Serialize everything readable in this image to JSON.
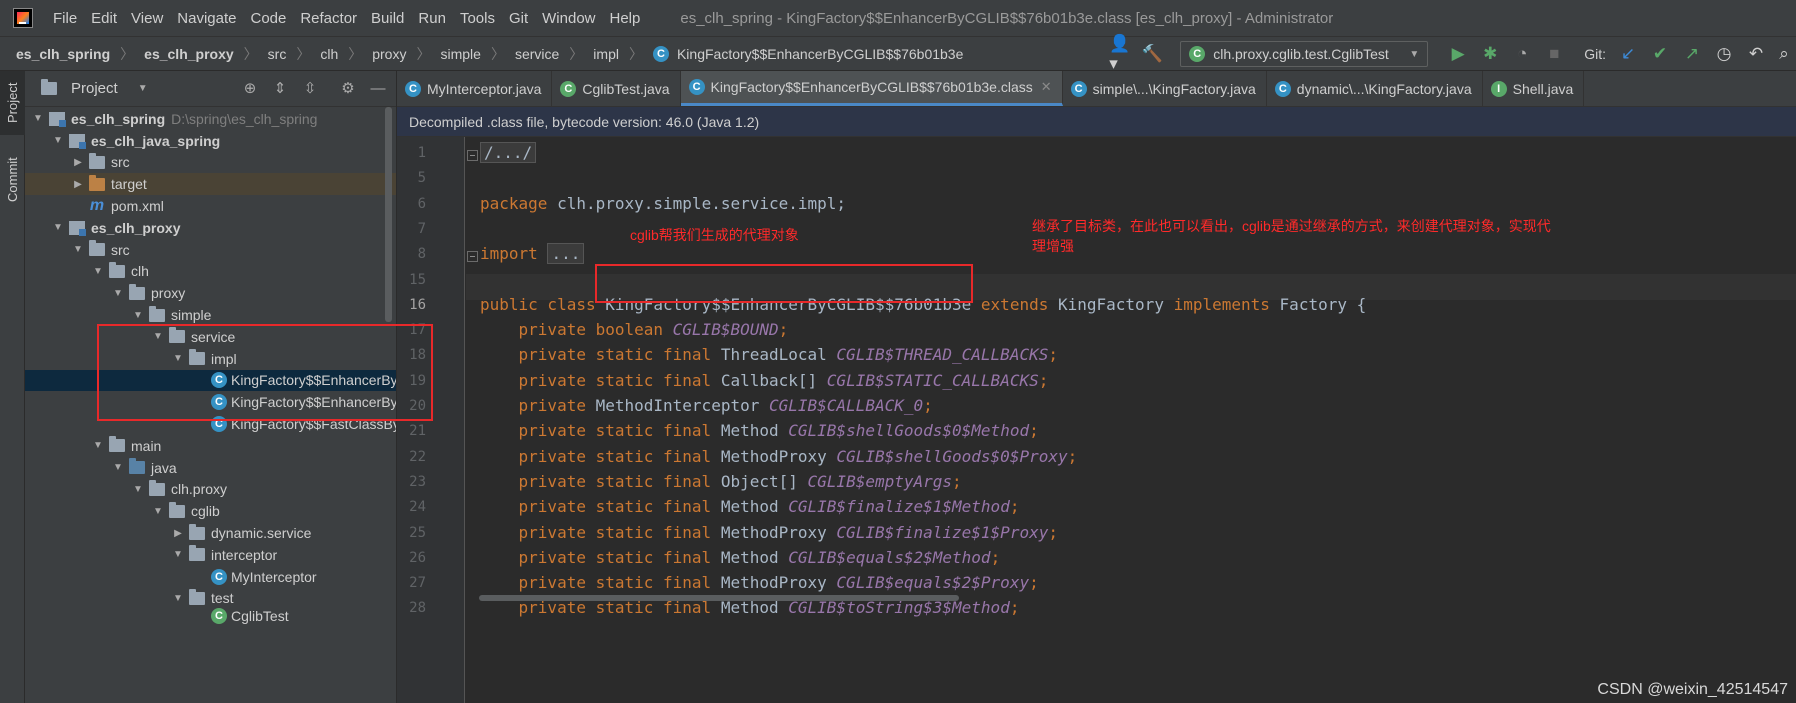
{
  "menubar": {
    "items": [
      "File",
      "Edit",
      "View",
      "Navigate",
      "Code",
      "Refactor",
      "Build",
      "Run",
      "Tools",
      "Git",
      "Window",
      "Help"
    ],
    "title": "es_clh_spring - KingFactory$$EnhancerByCGLIB$$76b01b3e.class [es_clh_proxy] - Administrator"
  },
  "breadcrumb": [
    "es_clh_spring",
    "es_clh_proxy",
    "src",
    "clh",
    "proxy",
    "simple",
    "service",
    "impl",
    "KingFactory$$EnhancerByCGLIB$$76b01b3e"
  ],
  "toolbar": {
    "run_config": "clh.proxy.cglib.test.CglibTest",
    "git_label": "Git:",
    "icons": [
      "user-icon",
      "hammer-icon",
      "run-icon",
      "debug-icon",
      "coverage-icon",
      "stop-icon",
      "git-update-icon",
      "git-commit-icon",
      "git-push-icon",
      "history-icon",
      "rollback-icon"
    ]
  },
  "stripe": {
    "project_label": "Project",
    "commit_label": "Commit"
  },
  "project_panel": {
    "title": "Project",
    "tree": [
      {
        "label": "es_clh_spring",
        "hint": "D:\\spring\\es_clh_spring"
      },
      {
        "label": "es_clh_java_spring"
      },
      {
        "label": "src"
      },
      {
        "label": "target"
      },
      {
        "label": "pom.xml"
      },
      {
        "label": "es_clh_proxy"
      },
      {
        "label": "src"
      },
      {
        "label": "clh"
      },
      {
        "label": "proxy"
      },
      {
        "label": "simple"
      },
      {
        "label": "service"
      },
      {
        "label": "impl"
      },
      {
        "label": "KingFactory$$EnhancerByCGLIB"
      },
      {
        "label": "KingFactory$$EnhancerByCGLIB"
      },
      {
        "label": "KingFactory$$FastClassByCGLIB"
      },
      {
        "label": "main"
      },
      {
        "label": "java"
      },
      {
        "label": "clh.proxy"
      },
      {
        "label": "cglib"
      },
      {
        "label": "dynamic.service"
      },
      {
        "label": "interceptor"
      },
      {
        "label": "MyInterceptor"
      },
      {
        "label": "test"
      },
      {
        "label": "CglibTest"
      }
    ]
  },
  "tabs": [
    {
      "label": "MyInterceptor.java"
    },
    {
      "label": "CglibTest.java"
    },
    {
      "label": "KingFactory$$EnhancerByCGLIB$$76b01b3e.class"
    },
    {
      "label": "simple\\...\\KingFactory.java"
    },
    {
      "label": "dynamic\\...\\KingFactory.java"
    },
    {
      "label": "Shell.java"
    }
  ],
  "banner": "Decompiled .class file, bytecode version: 46.0 (Java 1.2)",
  "editor": {
    "line_numbers": [
      "1",
      "5",
      "6",
      "7",
      "8",
      "15",
      "16",
      "17",
      "18",
      "19",
      "20",
      "21",
      "22",
      "23",
      "24",
      "25",
      "26",
      "27",
      "28"
    ],
    "lines": [
      [
        {
          "t": "/.../",
          "c": "folded"
        }
      ],
      [],
      [
        {
          "t": "package",
          "c": "kw"
        },
        {
          "t": " clh.proxy.simple.service.impl;",
          "c": ""
        }
      ],
      [],
      [
        {
          "t": "import",
          "c": "kw"
        },
        {
          "t": " ",
          "c": ""
        },
        {
          "t": "...",
          "c": "folded"
        }
      ],
      [],
      [
        {
          "t": "public class ",
          "c": "kw"
        },
        {
          "t": "KingFactory$$EnhancerByCGLIB$$76b01b3e",
          "c": ""
        },
        {
          "t": " extends ",
          "c": "kw"
        },
        {
          "t": "KingFactory ",
          "c": ""
        },
        {
          "t": "implements ",
          "c": "kw"
        },
        {
          "t": "Factory {",
          "c": ""
        }
      ],
      [
        {
          "t": "    private boolean ",
          "c": "kw"
        },
        {
          "t": "CGLIB$BOUND",
          "c": "fd"
        },
        {
          "t": ";",
          "c": "kw"
        }
      ],
      [
        {
          "t": "    private static final ",
          "c": "kw"
        },
        {
          "t": "ThreadLocal ",
          "c": ""
        },
        {
          "t": "CGLIB$THREAD_CALLBACKS",
          "c": "fd"
        },
        {
          "t": ";",
          "c": "kw"
        }
      ],
      [
        {
          "t": "    private static final ",
          "c": "kw"
        },
        {
          "t": "Callback[] ",
          "c": ""
        },
        {
          "t": "CGLIB$STATIC_CALLBACKS",
          "c": "fd"
        },
        {
          "t": ";",
          "c": "kw"
        }
      ],
      [
        {
          "t": "    private ",
          "c": "kw"
        },
        {
          "t": "MethodInterceptor ",
          "c": ""
        },
        {
          "t": "CGLIB$CALLBACK_0",
          "c": "fd"
        },
        {
          "t": ";",
          "c": "kw"
        }
      ],
      [
        {
          "t": "    private static final ",
          "c": "kw"
        },
        {
          "t": "Method ",
          "c": ""
        },
        {
          "t": "CGLIB$shellGoods$0$Method",
          "c": "fd"
        },
        {
          "t": ";",
          "c": "kw"
        }
      ],
      [
        {
          "t": "    private static final ",
          "c": "kw"
        },
        {
          "t": "MethodProxy ",
          "c": ""
        },
        {
          "t": "CGLIB$shellGoods$0$Proxy",
          "c": "fd"
        },
        {
          "t": ";",
          "c": "kw"
        }
      ],
      [
        {
          "t": "    private static final ",
          "c": "kw"
        },
        {
          "t": "Object[] ",
          "c": ""
        },
        {
          "t": "CGLIB$emptyArgs",
          "c": "fd"
        },
        {
          "t": ";",
          "c": "kw"
        }
      ],
      [
        {
          "t": "    private static final ",
          "c": "kw"
        },
        {
          "t": "Method ",
          "c": ""
        },
        {
          "t": "CGLIB$finalize$1$Method",
          "c": "fd"
        },
        {
          "t": ";",
          "c": "kw"
        }
      ],
      [
        {
          "t": "    private static final ",
          "c": "kw"
        },
        {
          "t": "MethodProxy ",
          "c": ""
        },
        {
          "t": "CGLIB$finalize$1$Proxy",
          "c": "fd"
        },
        {
          "t": ";",
          "c": "kw"
        }
      ],
      [
        {
          "t": "    private static final ",
          "c": "kw"
        },
        {
          "t": "Method ",
          "c": ""
        },
        {
          "t": "CGLIB$equals$2$Method",
          "c": "fd"
        },
        {
          "t": ";",
          "c": "kw"
        }
      ],
      [
        {
          "t": "    private static final ",
          "c": "kw"
        },
        {
          "t": "MethodProxy ",
          "c": ""
        },
        {
          "t": "CGLIB$equals$2$Proxy",
          "c": "fd"
        },
        {
          "t": ";",
          "c": "kw"
        }
      ],
      [
        {
          "t": "    private static final ",
          "c": "kw"
        },
        {
          "t": "Method ",
          "c": ""
        },
        {
          "t": "CGLIB$toString$3$Method",
          "c": "fd"
        },
        {
          "t": ";",
          "c": "kw"
        }
      ]
    ]
  },
  "annotations": {
    "note_import": "cglib帮我们生成的代理对象",
    "note_class": "继承了目标类，在此也可以看出，cglib是通过继承的方式，来创建代理对象，实现代理增强"
  },
  "watermark": "CSDN @weixin_42514547",
  "colors": {
    "keyword": "#cc7832",
    "field": "#9876aa",
    "annotation": "#ff2a2a",
    "selection": "#0d293e"
  }
}
